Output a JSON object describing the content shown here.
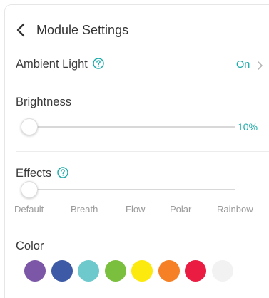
{
  "header": {
    "title": "Module Settings"
  },
  "ambient": {
    "label": "Ambient Light",
    "value": "On"
  },
  "brightness": {
    "label": "Brightness",
    "value_label": "10%",
    "level": 0.1
  },
  "effects": {
    "label": "Effects",
    "options": [
      "Default",
      "Breath",
      "Flow",
      "Polar",
      "Rainbow"
    ],
    "selected": "Default"
  },
  "color": {
    "label": "Color",
    "swatches": [
      "#7d57a7",
      "#3c5aa6",
      "#6ec9cd",
      "#7bbf3f",
      "#fce90d",
      "#f58025",
      "#ea1c41",
      "#f2f2f2"
    ]
  },
  "accent": "#19a9a7"
}
